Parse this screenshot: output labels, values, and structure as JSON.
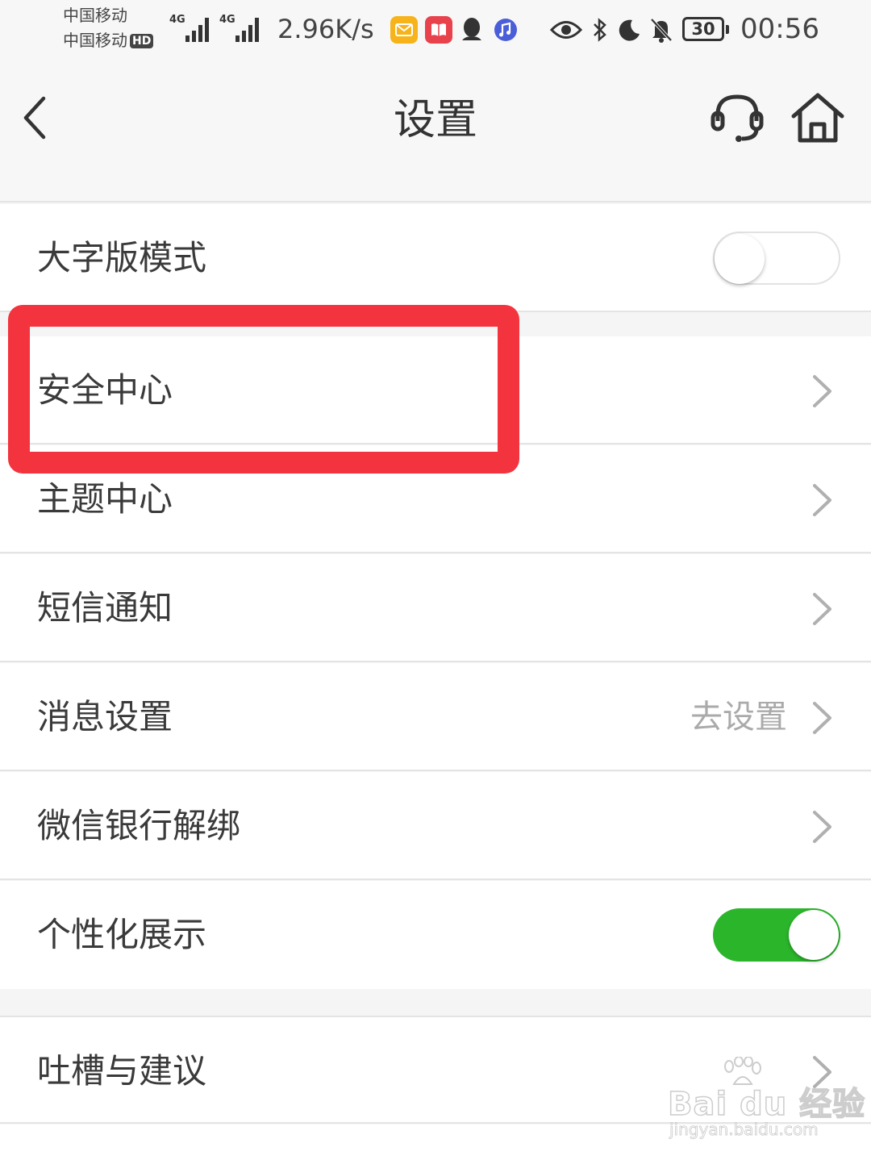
{
  "status_bar": {
    "carrier1": "中国移动",
    "carrier2": "中国移动",
    "hd_badge": "HD",
    "signal1_label": "4G",
    "signal2_label": "4G",
    "net_speed": "2.96K/s",
    "battery": "30",
    "time": "00:56",
    "icons": [
      "email-app-icon",
      "book-app-icon",
      "qq-icon",
      "music-icon",
      "eye-icon",
      "bluetooth-icon",
      "moon-icon",
      "bell-off-icon"
    ]
  },
  "header": {
    "title": "设置",
    "icons": [
      "back-chevron-icon",
      "headset-icon",
      "home-icon"
    ]
  },
  "settings": {
    "large_font": {
      "label": "大字版模式",
      "enabled": false
    },
    "security": {
      "label": "安全中心"
    },
    "theme": {
      "label": "主题中心"
    },
    "sms": {
      "label": "短信通知"
    },
    "message": {
      "label": "消息设置",
      "value": "去设置"
    },
    "wechat_unbind": {
      "label": "微信银行解绑"
    },
    "personalized": {
      "label": "个性化展示",
      "enabled": true
    },
    "feedback": {
      "label": "吐槽与建议"
    }
  },
  "highlight_color": "#f3343e",
  "toggle_on_color": "#2bb52b",
  "watermark": {
    "main": "Bai du 经验",
    "url": "jingyan.baidu.com"
  }
}
